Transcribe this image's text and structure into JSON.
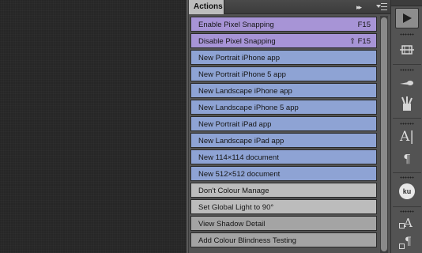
{
  "panel": {
    "tab_label": "Actions",
    "collapse_glyph": "▸▸",
    "menu_icon": "panel-menu-icon"
  },
  "actions": [
    {
      "label": "Enable Pixel Snapping",
      "shortcut": "F15",
      "color": "#a794d6"
    },
    {
      "label": "Disable Pixel Snapping",
      "shortcut": "⇧ F15",
      "color": "#a794d6"
    },
    {
      "label": "New Portrait iPhone app",
      "shortcut": "",
      "color": "#8ea3d4"
    },
    {
      "label": "New Portrait iPhone 5 app",
      "shortcut": "",
      "color": "#8ea3d4"
    },
    {
      "label": "New Landscape iPhone app",
      "shortcut": "",
      "color": "#8ea3d4"
    },
    {
      "label": "New Landscape iPhone 5 app",
      "shortcut": "",
      "color": "#8ea3d4"
    },
    {
      "label": "New Portrait iPad app",
      "shortcut": "",
      "color": "#8ea3d4"
    },
    {
      "label": "New Landscape iPad app",
      "shortcut": "",
      "color": "#8ea3d4"
    },
    {
      "label": "New 114×114 document",
      "shortcut": "",
      "color": "#8ea3d4"
    },
    {
      "label": "New 512×512 document",
      "shortcut": "",
      "color": "#8ea3d4"
    },
    {
      "label": "Don't Colour Manage",
      "shortcut": "",
      "color": "#bcbcbc"
    },
    {
      "label": "Set Global Light to 90°",
      "shortcut": "",
      "color": "#bcbcbc"
    },
    {
      "label": "View Shadow Detail",
      "shortcut": "",
      "color": "#a4a4a4"
    },
    {
      "label": "Add Colour Blindness Testing",
      "shortcut": "",
      "color": "#a4a4a4"
    }
  ],
  "toolbar": {
    "play_icon": "play-icon",
    "text_glyph": "A|",
    "paragraph_glyph": "¶",
    "ku_label": "ku",
    "char_style_glyph": "A",
    "para_style_glyph": "¶"
  }
}
